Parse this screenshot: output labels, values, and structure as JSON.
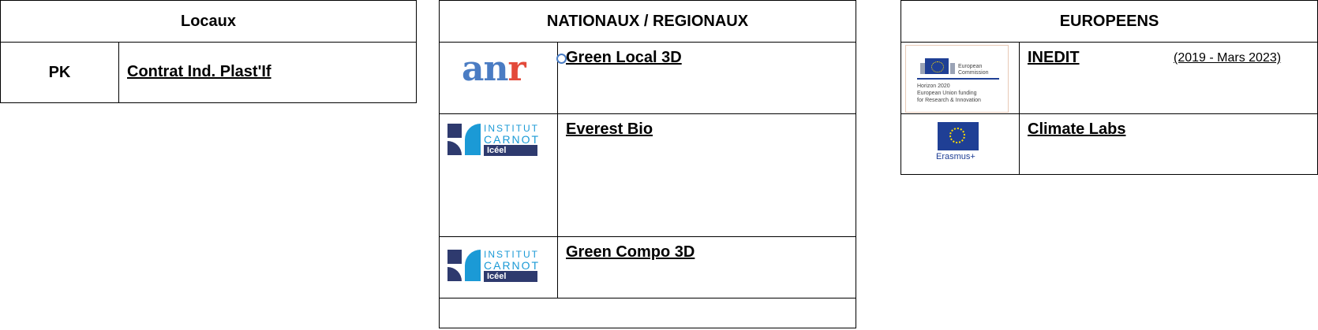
{
  "locaux": {
    "header": "Locaux",
    "rows": [
      {
        "left": "PK",
        "link": "Contrat Ind. Plast'If"
      }
    ]
  },
  "nationaux": {
    "header": "NATIONAUX / REGIONAUX",
    "rows": [
      {
        "logo": "anr-logo",
        "logo_text_a": "an",
        "logo_text_b": "r",
        "link": "Green Local 3D"
      },
      {
        "logo": "institut-carnot-logo",
        "logo_line1": "INSTITUT",
        "logo_line2": "CARNOT",
        "logo_line3": "Icéel",
        "link": "Everest Bio"
      },
      {
        "logo": "institut-carnot-logo",
        "logo_line1": "INSTITUT",
        "logo_line2": "CARNOT",
        "logo_line3": "Icéel",
        "link": "Green Compo 3D"
      }
    ]
  },
  "europeens": {
    "header": "EUROPEENS",
    "rows": [
      {
        "logo": "european-commission-logo",
        "logo_title_1": "European",
        "logo_title_2": "Commission",
        "logo_sub_1": "Horizon 2020",
        "logo_sub_2": "European Union funding",
        "logo_sub_3": "for Research & Innovation",
        "link": "INEDIT",
        "dates": "(2019 - Mars 2023)"
      },
      {
        "logo": "erasmus-plus-logo",
        "logo_text": "Erasmus+",
        "link": "Climate Labs"
      }
    ]
  }
}
